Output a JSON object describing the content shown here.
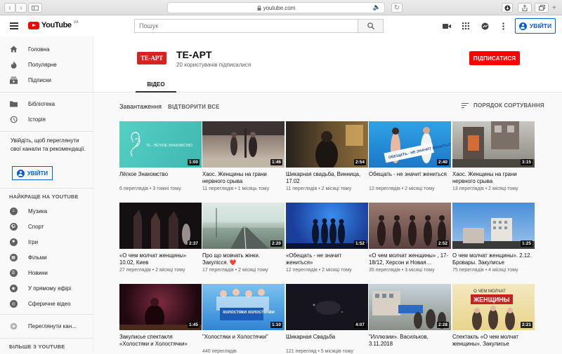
{
  "browser": {
    "url": "youtube.com"
  },
  "header": {
    "logo_text": "YouTube",
    "logo_region": "UA",
    "search_placeholder": "Пошук",
    "signin_label": "УВІЙТИ"
  },
  "sidebar": {
    "main": [
      {
        "label": "Головна",
        "icon": "home-icon"
      },
      {
        "label": "Популярне",
        "icon": "fire-icon"
      },
      {
        "label": "Підписки",
        "icon": "subscriptions-icon"
      }
    ],
    "library": [
      {
        "label": "Бібліотека",
        "icon": "folder-icon"
      },
      {
        "label": "Історія",
        "icon": "history-icon"
      }
    ],
    "signin_note": "Увійдіть, щоб переглянути свої канали та рекомендації.",
    "signin_label": "УВІЙТИ",
    "best_heading": "НАЙКРАЩЕ НА YOUTUBE",
    "best": [
      {
        "label": "Музика",
        "icon": "music-icon"
      },
      {
        "label": "Спорт",
        "icon": "sport-icon"
      },
      {
        "label": "Ігри",
        "icon": "games-icon"
      },
      {
        "label": "Фільми",
        "icon": "film-icon"
      },
      {
        "label": "Новини",
        "icon": "news-icon"
      },
      {
        "label": "У прямому ефірі",
        "icon": "live-icon"
      },
      {
        "label": "Сферичне відео",
        "icon": "360-icon"
      }
    ],
    "browse_channels": "Переглянути кан...",
    "more_heading": "БІЛЬШЕ З YOUTUBE"
  },
  "channel": {
    "logo_text": "TE-APT",
    "name": "TE-APT",
    "subscribers": "20 користувачів підписалися",
    "subscribe_label": "ПІДПИСАТИСЯ",
    "tab_label": "ВІДЕО"
  },
  "content": {
    "uploads_label": "Завантаження",
    "play_all_label": "ВІДТВОРИТИ ВСЕ",
    "sort_label": "ПОРЯДОК СОРТУВАННЯ"
  },
  "videos": [
    {
      "title": "Лёгкое Знакомство",
      "meta": "6 переглядів • 3 тижні тому",
      "duration": "1:00"
    },
    {
      "title": "Хаос. Женщины на грани нервного срыва",
      "meta": "11 переглядів • 1 місяць тому",
      "duration": "1:46"
    },
    {
      "title": "Шикарная свадьба, Винница, 17.02",
      "meta": "11 переглядів • 2 місяці тому",
      "duration": "2:54"
    },
    {
      "title": "Обещать - не значит жениться",
      "meta": "12 переглядів • 2 місяці тому",
      "duration": "2:40"
    },
    {
      "title": "Хаос. Женщины на грани нервного срыва",
      "meta": "13 переглядів • 2 місяці тому",
      "duration": "3:15"
    },
    {
      "title": "«О чем молчат женщины» 10.02, Киев",
      "meta": "27 переглядів • 2 місяці тому",
      "duration": "2:37"
    },
    {
      "title": "Про що мовчать жінки. Закулісся. ❤️",
      "meta": "17 переглядів • 2 місяці тому",
      "duration": "2:20"
    },
    {
      "title": "«Обещать - не значит жениться»",
      "meta": "12 переглядів • 2 місяці тому",
      "duration": "1:52"
    },
    {
      "title": "«О чем молчат женщины» , 17-18/12, Херсон и Новая…",
      "meta": "35 переглядів • 3 місяці тому",
      "duration": "2:52"
    },
    {
      "title": "О чем молчат женщины». 2.12. Бровары. Закулисье",
      "meta": "75 переглядів • 4 місяці тому",
      "duration": "1:25"
    },
    {
      "title": "Закулисье спектакля «Холостяки и Холостячки»",
      "meta": "",
      "duration": "1:45"
    },
    {
      "title": "\"Холостяки и Холостячки\"",
      "meta": "440 переглядів",
      "duration": "1:10"
    },
    {
      "title": "Шикарная Свадьба",
      "meta": "121 перегляд • 5 місяців тому",
      "duration": "4:07"
    },
    {
      "title": "\"Иллюзии». Васильков, 3.11.2018",
      "meta": "",
      "duration": "2:28"
    },
    {
      "title": "Спектакль «О чем молчат женщины». Закулисье",
      "meta": "",
      "duration": "2:21"
    }
  ],
  "thumb_overlays": {
    "v0": "TE - ЛЁГКОЕ ЗНАКОМСТВО",
    "v3": "ОБЕЩАТЬ - НЕ ЗНАЧИТ ЖЕНИТЬСЯ",
    "v11": "ХОЛОСТЯКИ ХОЛОСТЯЧКИ",
    "v14a": "О ЧЕМ МОЛЧАТ",
    "v14b": "ЖЕНЩИНЫ"
  }
}
